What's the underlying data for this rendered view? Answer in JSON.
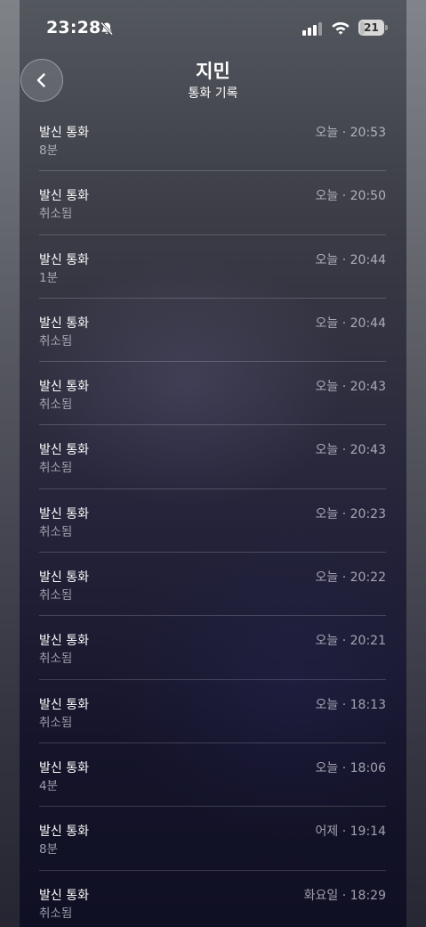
{
  "status_bar": {
    "time": "23:28",
    "battery": "21",
    "battery_level": 0.21,
    "icons": [
      "bell-slash-icon",
      "cellular-signal-icon",
      "wifi-icon",
      "battery-icon"
    ]
  },
  "header": {
    "title": "지민",
    "subtitle": "통화 기록",
    "back_icon": "chevron-left-icon"
  },
  "calls": [
    {
      "type": "발신 통화",
      "detail": "8분",
      "time": "오늘 · 20:53"
    },
    {
      "type": "발신 통화",
      "detail": "취소됨",
      "time": "오늘 · 20:50"
    },
    {
      "type": "발신 통화",
      "detail": "1분",
      "time": "오늘 · 20:44"
    },
    {
      "type": "발신 통화",
      "detail": "취소됨",
      "time": "오늘 · 20:44"
    },
    {
      "type": "발신 통화",
      "detail": "취소됨",
      "time": "오늘 · 20:43"
    },
    {
      "type": "발신 통화",
      "detail": "취소됨",
      "time": "오늘 · 20:43"
    },
    {
      "type": "발신 통화",
      "detail": "취소됨",
      "time": "오늘 · 20:23"
    },
    {
      "type": "발신 통화",
      "detail": "취소됨",
      "time": "오늘 · 20:22"
    },
    {
      "type": "발신 통화",
      "detail": "취소됨",
      "time": "오늘 · 20:21"
    },
    {
      "type": "발신 통화",
      "detail": "취소됨",
      "time": "오늘 · 18:13"
    },
    {
      "type": "발신 통화",
      "detail": "4분",
      "time": "오늘 · 18:06"
    },
    {
      "type": "발신 통화",
      "detail": "8분",
      "time": "어제 · 19:14"
    },
    {
      "type": "발신 통화",
      "detail": "취소됨",
      "time": "화요일 · 18:29"
    }
  ]
}
